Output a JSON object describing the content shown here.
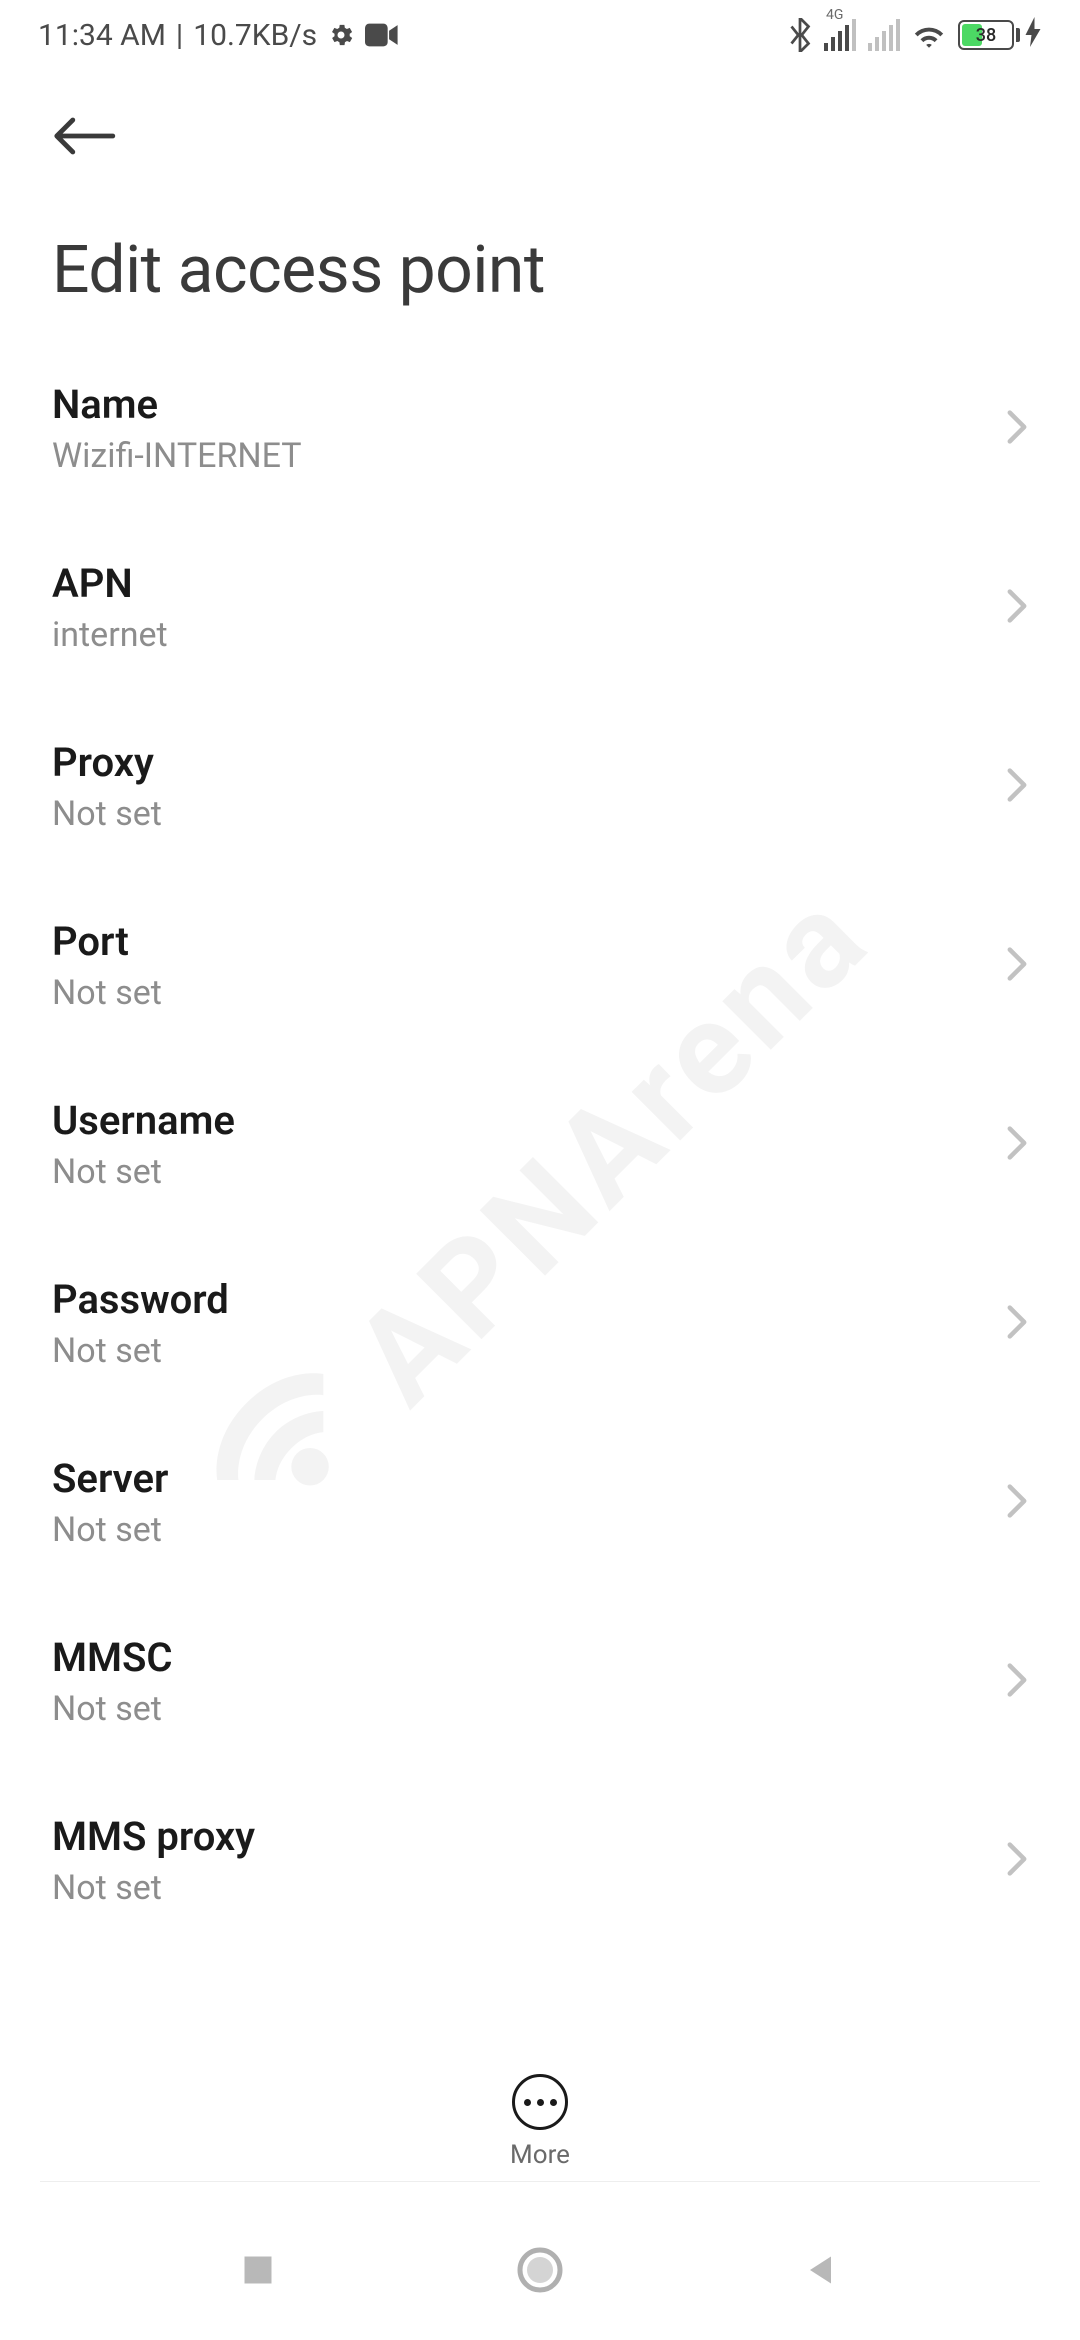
{
  "status": {
    "time": "11:34 AM",
    "sep": "|",
    "speed": "10.7KB/s",
    "signal_label": "4G",
    "battery_pct": "38"
  },
  "header": {
    "title": "Edit access point"
  },
  "settings": [
    {
      "label": "Name",
      "value": "Wizifi-INTERNET"
    },
    {
      "label": "APN",
      "value": "internet"
    },
    {
      "label": "Proxy",
      "value": "Not set"
    },
    {
      "label": "Port",
      "value": "Not set"
    },
    {
      "label": "Username",
      "value": "Not set"
    },
    {
      "label": "Password",
      "value": "Not set"
    },
    {
      "label": "Server",
      "value": "Not set"
    },
    {
      "label": "MMSC",
      "value": "Not set"
    },
    {
      "label": "MMS proxy",
      "value": "Not set"
    }
  ],
  "more_label": "More",
  "watermark": "APNArena"
}
